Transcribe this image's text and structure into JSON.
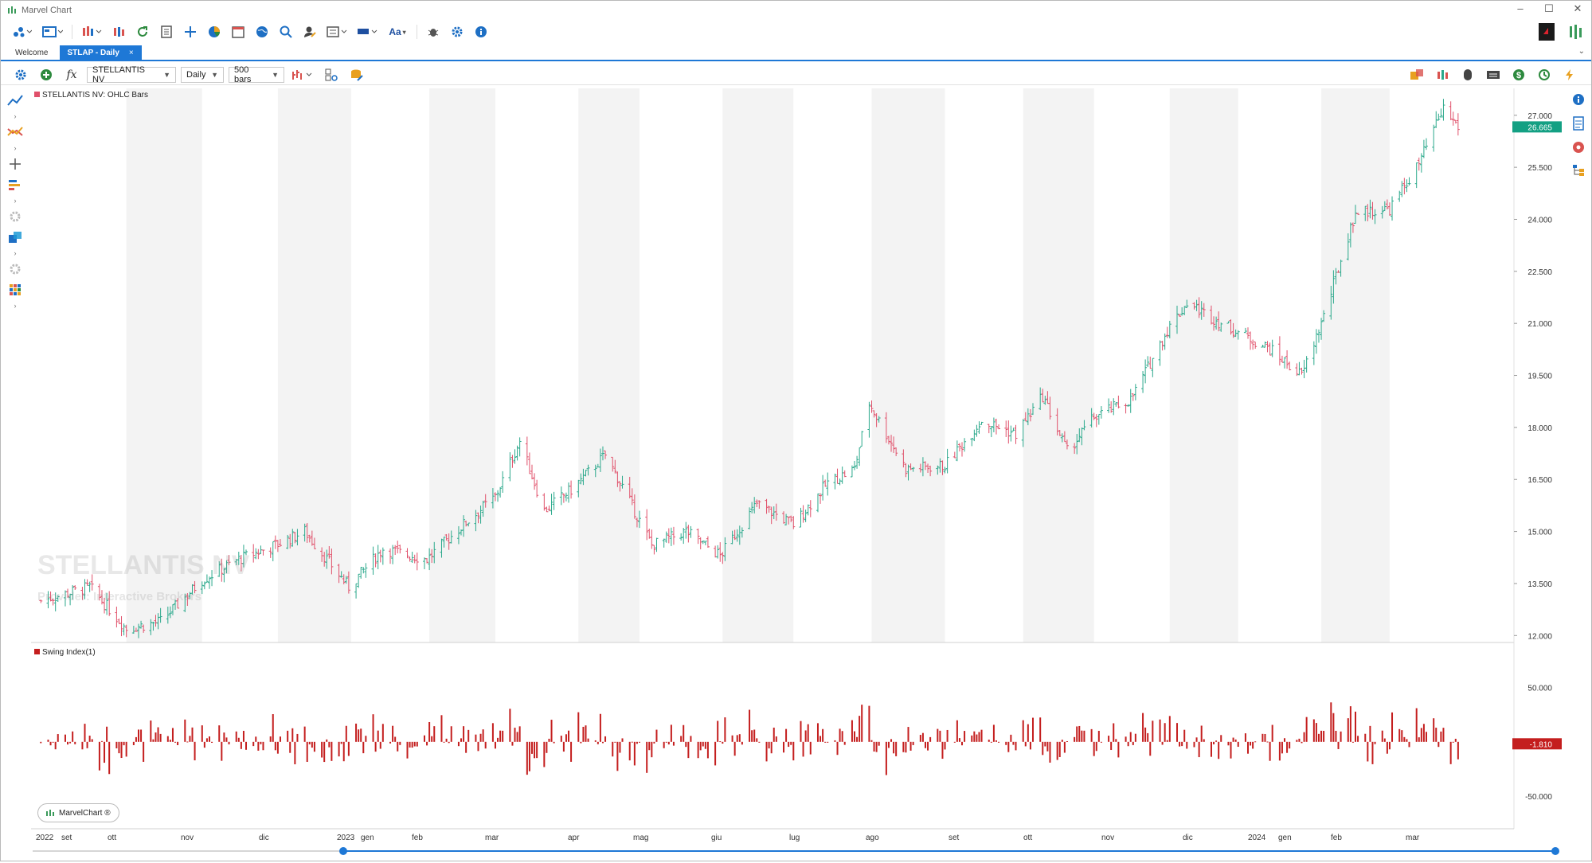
{
  "window": {
    "title": "Marvel Chart",
    "controls": [
      "–",
      "☐",
      "✕"
    ]
  },
  "tabs": [
    {
      "label": "Welcome",
      "active": false
    },
    {
      "label": "STLAP - Daily",
      "active": true,
      "close": "×"
    }
  ],
  "tab_overflow": "⌄",
  "toolbar": {
    "symbol": "STELLANTIS NV",
    "timeframe": "Daily",
    "bars": "500 bars",
    "fx_label": "fx"
  },
  "price_panel": {
    "legend": "STELLANTIS NV: OHLC Bars",
    "watermark_name": "STELLANTIS NV",
    "watermark_provider": "Provider: Interactive Brokers",
    "last_price": "26.665",
    "axis_labels": [
      "27.000",
      "25.500",
      "24.000",
      "22.500",
      "21.000",
      "19.500",
      "18.000",
      "16.500",
      "15.000",
      "13.500",
      "12.000"
    ]
  },
  "indicator_panel": {
    "legend": "Swing Index(1)",
    "last_value": "-1.810",
    "axis_labels": [
      "50.000",
      "-50.000"
    ]
  },
  "badge": "MarvelChart ®",
  "time_axis": [
    "2022",
    "set",
    "ott",
    "nov",
    "dic",
    "2023",
    "gen",
    "feb",
    "mar",
    "apr",
    "mag",
    "giu",
    "lug",
    "ago",
    "set",
    "ott",
    "nov",
    "dic",
    "2024",
    "gen",
    "feb",
    "mar"
  ],
  "chart_data": {
    "type": "ohlc",
    "symbol": "STELLANTIS NV",
    "interval": "Daily",
    "close_series_approx": [
      {
        "x": "2022-08-26",
        "y": 13.0
      },
      {
        "x": "2022-09-15",
        "y": 13.4
      },
      {
        "x": "2022-09-30",
        "y": 12.2
      },
      {
        "x": "2022-10-14",
        "y": 12.4
      },
      {
        "x": "2022-10-31",
        "y": 13.6
      },
      {
        "x": "2022-11-15",
        "y": 14.2
      },
      {
        "x": "2022-11-30",
        "y": 14.6
      },
      {
        "x": "2022-12-12",
        "y": 15.0
      },
      {
        "x": "2022-12-30",
        "y": 13.4
      },
      {
        "x": "2023-01-13",
        "y": 14.5
      },
      {
        "x": "2023-01-31",
        "y": 14.2
      },
      {
        "x": "2023-02-15",
        "y": 15.2
      },
      {
        "x": "2023-02-28",
        "y": 16.0
      },
      {
        "x": "2023-03-10",
        "y": 17.6
      },
      {
        "x": "2023-03-20",
        "y": 15.6
      },
      {
        "x": "2023-03-31",
        "y": 16.2
      },
      {
        "x": "2023-04-14",
        "y": 17.2
      },
      {
        "x": "2023-04-21",
        "y": 16.3
      },
      {
        "x": "2023-05-03",
        "y": 14.6
      },
      {
        "x": "2023-05-17",
        "y": 15.0
      },
      {
        "x": "2023-05-31",
        "y": 14.3
      },
      {
        "x": "2023-06-15",
        "y": 15.8
      },
      {
        "x": "2023-06-30",
        "y": 15.2
      },
      {
        "x": "2023-07-14",
        "y": 16.4
      },
      {
        "x": "2023-07-25",
        "y": 16.8
      },
      {
        "x": "2023-07-31",
        "y": 18.7
      },
      {
        "x": "2023-08-15",
        "y": 16.8
      },
      {
        "x": "2023-08-31",
        "y": 16.9
      },
      {
        "x": "2023-09-15",
        "y": 18.2
      },
      {
        "x": "2023-09-29",
        "y": 17.8
      },
      {
        "x": "2023-10-10",
        "y": 18.9
      },
      {
        "x": "2023-10-20",
        "y": 17.3
      },
      {
        "x": "2023-10-31",
        "y": 18.3
      },
      {
        "x": "2023-11-15",
        "y": 18.8
      },
      {
        "x": "2023-11-30",
        "y": 20.8
      },
      {
        "x": "2023-12-08",
        "y": 21.6
      },
      {
        "x": "2023-12-22",
        "y": 21.0
      },
      {
        "x": "2024-01-10",
        "y": 20.3
      },
      {
        "x": "2024-01-24",
        "y": 19.5
      },
      {
        "x": "2024-02-02",
        "y": 21.2
      },
      {
        "x": "2024-02-15",
        "y": 24.2
      },
      {
        "x": "2024-02-29",
        "y": 24.3
      },
      {
        "x": "2024-03-12",
        "y": 25.6
      },
      {
        "x": "2024-03-22",
        "y": 27.2
      },
      {
        "x": "2024-03-28",
        "y": 26.665
      }
    ],
    "ylim": [
      11.8,
      27.5
    ],
    "indicator": {
      "name": "Swing Index(1)",
      "ylim": [
        -80,
        90
      ],
      "last": -1.81
    }
  },
  "colors": {
    "up_bar": "#2aa88b",
    "down_bar": "#e0506a",
    "swing_bar": "#c41e1e",
    "price_tag": "#13a083",
    "indicator_tag": "#c41e1e",
    "accent": "#1e78d6",
    "band": "#f3f3f3"
  }
}
